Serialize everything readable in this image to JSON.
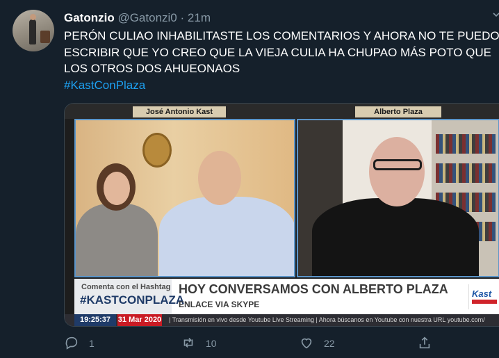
{
  "tweet": {
    "display_name": "Gatonzio",
    "handle": "@Gatonzi0",
    "separator": "·",
    "time": "21m",
    "text_lines": [
      "PERÓN CULIAO INHABILITASTE LOS COMENTARIOS Y AHORA NO TE PUEDO",
      "ESCRIBIR QUE YO CREO QUE LA VIEJA CULIA HA CHUPAO MÁS POTO QUE",
      "LOS OTROS DOS AHUEONAOS"
    ],
    "hashtag": "#KastConPlaza"
  },
  "media": {
    "left_label": "José Antonio Kast",
    "right_label": "Alberto Plaza",
    "lower_third": {
      "hashtag_small": "Comenta con el Hashtag",
      "hashtag_big": "#KASTCONPLAZA",
      "headline": "HOY CONVERSAMOS CON ALBERTO PLAZA",
      "subheadline": "ENLACE VIA SKYPE",
      "logo_text": "Kast"
    },
    "ticker": {
      "clock": "19:25:37",
      "date": "31 Mar 2020",
      "text": "|  Transmisión en vivo desde Youtube Live Streaming   |   Ahora búscanos en Youtube con nuestra URL youtube.com/"
    }
  },
  "actions": {
    "reply_count": "1",
    "retweet_count": "10",
    "like_count": "22"
  },
  "colors": {
    "background": "#15202b",
    "secondary_text": "#8899a6",
    "link": "#1da1f2"
  }
}
